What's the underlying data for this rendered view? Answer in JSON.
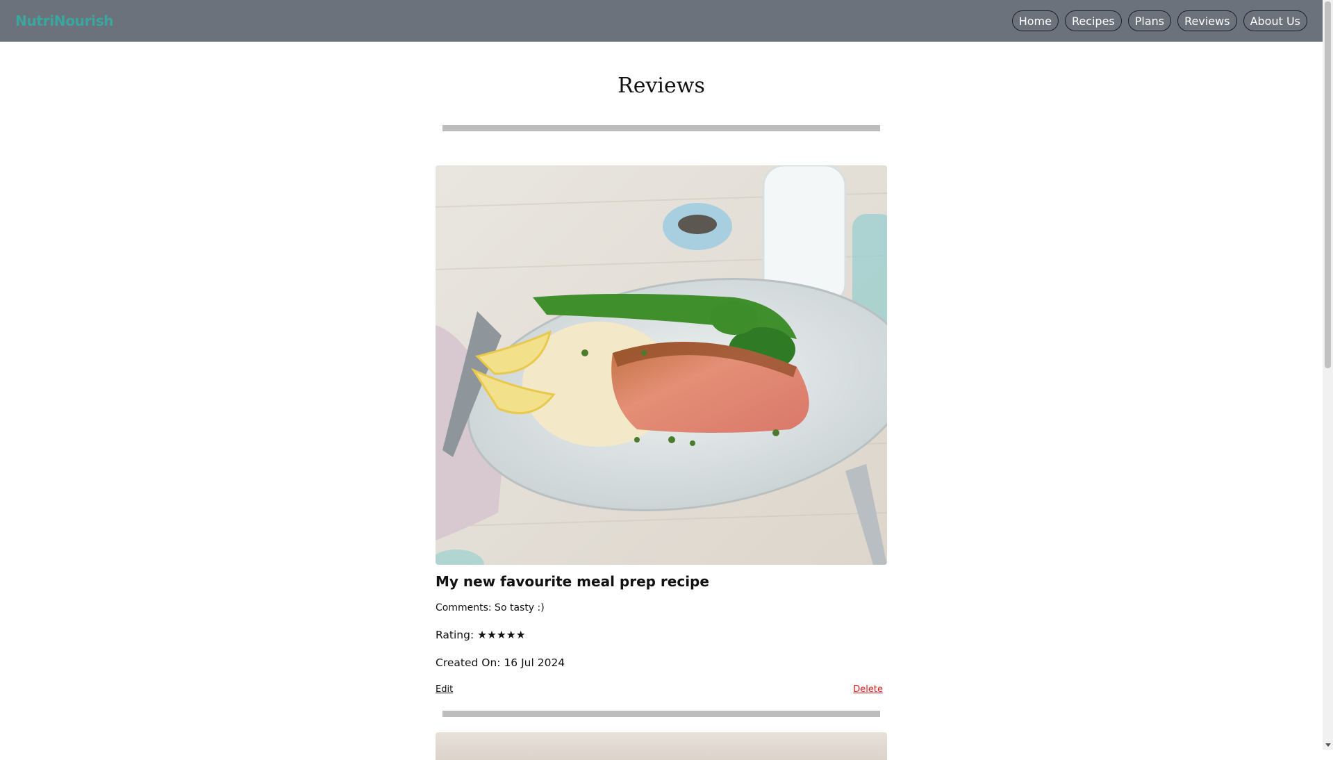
{
  "brand": "NutriNourish",
  "nav": [
    {
      "label": "Home"
    },
    {
      "label": "Recipes"
    },
    {
      "label": "Plans"
    },
    {
      "label": "Reviews"
    },
    {
      "label": "About Us"
    }
  ],
  "page": {
    "title": "Reviews"
  },
  "reviews": [
    {
      "title": "My new favourite meal prep recipe",
      "comments": "Comments: So tasty :)",
      "rating": "Rating: ★★★★★",
      "created": "Created On: 16 Jul 2024",
      "edit_label": "Edit",
      "delete_label": "Delete"
    }
  ],
  "colors": {
    "navbar": "#6b727b",
    "brand": "#3aa6a0",
    "delete": "#e0191b"
  }
}
